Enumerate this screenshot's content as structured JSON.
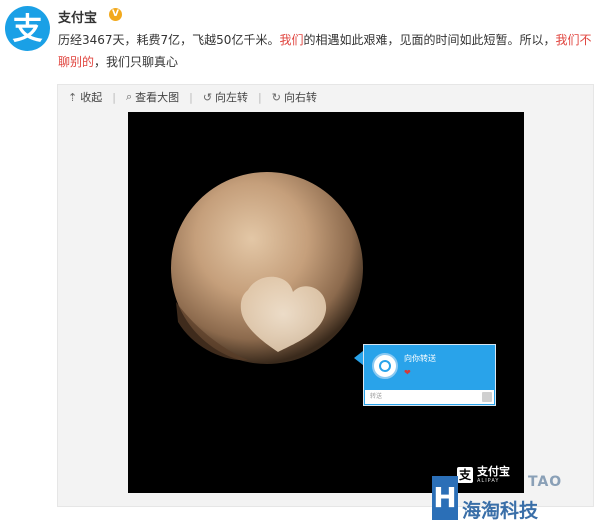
{
  "account": {
    "name": "支付宝",
    "verified_badge": "V",
    "avatar_icon": "alipay-logo-icon",
    "avatar_color": "#1aa0e6"
  },
  "post": {
    "text_1": "历经3467天，耗费7亿，飞越50亿千米。",
    "text_red_1": "我们",
    "text_2": "的相遇如此艰难，见面的时间如此短暂。所以，",
    "text_red_2": "我们不聊别的",
    "text_3": "，我们只聊真心",
    "highlight_color": "#e0443e"
  },
  "toolbar": {
    "collapse": "收起",
    "view_large": "查看大图",
    "rotate_left": "向左转",
    "rotate_right": "向右转"
  },
  "dialog": {
    "title": "向你转送",
    "heart": "❤",
    "input_placeholder": "转送",
    "color": "#29a3ea"
  },
  "watermark": {
    "logo": "支",
    "brand": "支付宝",
    "sub": "ALIPAY"
  },
  "corner_mark": {
    "badge": "H",
    "tao": "TAO",
    "name": "海淘科技"
  }
}
